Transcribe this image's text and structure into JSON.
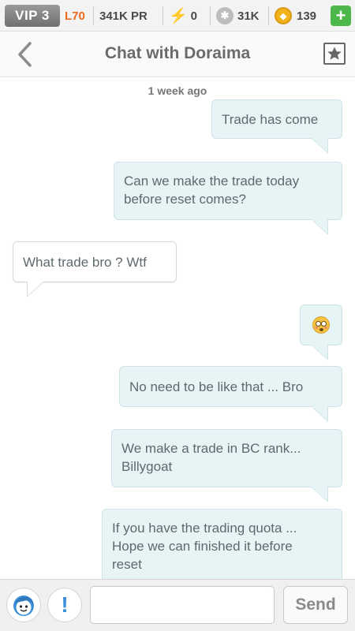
{
  "status_bar": {
    "vip": "VIP 3",
    "level": "L70",
    "pr": "341K PR",
    "energy_icon": "lightning-icon",
    "energy": "0",
    "paw_icon": "paw-icon",
    "paw": "31K",
    "coin_icon": "coin-icon",
    "coins": "139",
    "add_label": "+"
  },
  "header": {
    "back_icon": "chevron-left-icon",
    "title": "Chat with Doraima",
    "favorite_icon": "star-icon"
  },
  "chat": {
    "timestamp": "1 week ago",
    "messages": [
      {
        "direction": "out",
        "lines": [
          "Trade has come"
        ]
      },
      {
        "direction": "out",
        "lines": [
          "Can we make the trade today",
          "before reset comes?"
        ]
      },
      {
        "direction": "in",
        "lines": [
          "What trade bro ? Wtf"
        ]
      },
      {
        "direction": "out",
        "emoji": "flushed-face-emoji"
      },
      {
        "direction": "out",
        "lines": [
          "No need to be like that ... Bro"
        ]
      },
      {
        "direction": "out",
        "lines": [
          "We make a trade in BC rank...",
          "Billygoat"
        ]
      },
      {
        "direction": "out",
        "lines": [
          "If you have the trading quota ...",
          "Hope we can finished it before",
          "reset"
        ]
      }
    ]
  },
  "input_bar": {
    "avatar_icon": "avatar-icon",
    "alert_icon": "exclamation-icon",
    "alert_label": "!",
    "message_value": "",
    "message_placeholder": "",
    "send_label": "Send"
  },
  "colors": {
    "outgoing_bubble": "#e6f4f6",
    "incoming_bubble": "#ffffff",
    "level_accent": "#ef6a1c",
    "add_button": "#4cb84c",
    "alert_blue": "#3a8fd8"
  }
}
